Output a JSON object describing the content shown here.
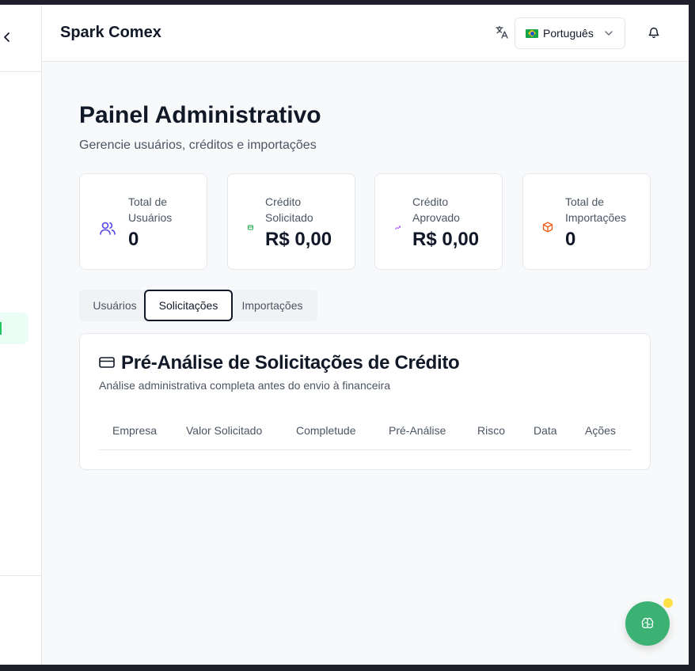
{
  "header": {
    "app_title": "Spark Comex",
    "language": {
      "selected": "Português",
      "flag": "brazil-flag-icon"
    }
  },
  "page": {
    "title": "Painel Administrativo",
    "subtitle": "Gerencie usuários, créditos e importações"
  },
  "stats": [
    {
      "label": "Total de Usuários",
      "value": "0",
      "icon": "users-icon",
      "color": "#4f46e5"
    },
    {
      "label": "Crédito Solicitado",
      "value": "R$ 0,00",
      "icon": "credit-card-icon",
      "color": "#16a34a"
    },
    {
      "label": "Crédito Aprovado",
      "value": "R$ 0,00",
      "icon": "trending-up-icon",
      "color": "#a855f7"
    },
    {
      "label": "Total de Importações",
      "value": "0",
      "icon": "package-icon",
      "color": "#ea580c"
    }
  ],
  "tabs": [
    {
      "label": "Usuários",
      "active": false
    },
    {
      "label": "Solicitações",
      "active": true
    },
    {
      "label": "Importações",
      "active": false
    }
  ],
  "panel": {
    "title": "Pré-Análise de Solicitações de Crédito",
    "description": "Análise administrativa completa antes do envio à financeira",
    "columns": [
      "Empresa",
      "Valor Solicitado",
      "Completude",
      "Pré-Análise",
      "Risco",
      "Data",
      "Ações"
    ]
  },
  "colors": {
    "accent": "#3bb273",
    "notification_dot": "#fde047",
    "active_nav": "#ecfdf5"
  }
}
